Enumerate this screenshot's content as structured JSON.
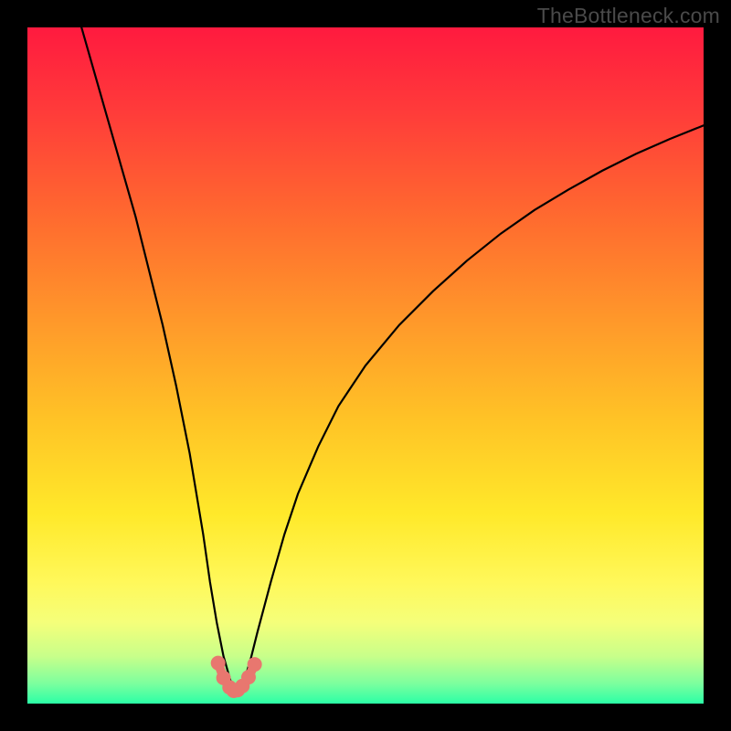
{
  "watermark": "TheBottleneck.com",
  "chart_data": {
    "type": "line",
    "title": "",
    "xlabel": "",
    "ylabel": "",
    "xlim": [
      0,
      100
    ],
    "ylim": [
      0,
      100
    ],
    "grid": false,
    "legend": false,
    "background_gradient_stops": [
      {
        "offset": 0.0,
        "color": "#ff1a3f"
      },
      {
        "offset": 0.12,
        "color": "#ff3a3a"
      },
      {
        "offset": 0.28,
        "color": "#ff6a2f"
      },
      {
        "offset": 0.44,
        "color": "#ff9a2a"
      },
      {
        "offset": 0.58,
        "color": "#ffc326"
      },
      {
        "offset": 0.72,
        "color": "#ffe92a"
      },
      {
        "offset": 0.82,
        "color": "#fff85a"
      },
      {
        "offset": 0.88,
        "color": "#f5ff7a"
      },
      {
        "offset": 0.93,
        "color": "#c8ff8a"
      },
      {
        "offset": 0.97,
        "color": "#7dff9e"
      },
      {
        "offset": 1.0,
        "color": "#2bffa6"
      }
    ],
    "series": [
      {
        "name": "bottleneck-curve",
        "color": "#000000",
        "stroke_width": 2.2,
        "x": [
          8,
          10,
          12,
          14,
          16,
          18,
          20,
          22,
          24,
          26,
          27,
          28,
          29,
          30,
          30.5,
          31,
          31.5,
          32,
          33,
          34,
          36,
          38,
          40,
          43,
          46,
          50,
          55,
          60,
          65,
          70,
          75,
          80,
          85,
          90,
          95,
          100
        ],
        "y": [
          100,
          93,
          86,
          79,
          72,
          64,
          56,
          47,
          37,
          25,
          18,
          12,
          7,
          3.5,
          2.3,
          1.8,
          2.0,
          3.2,
          6.5,
          10.5,
          18,
          25,
          31,
          38,
          44,
          50,
          56,
          61,
          65.5,
          69.5,
          73,
          76,
          78.8,
          81.3,
          83.5,
          85.5
        ]
      },
      {
        "name": "marker-arc",
        "type": "scatter",
        "color": "#e8776f",
        "marker_radius": 8,
        "connect": true,
        "connect_width": 10,
        "x": [
          28.2,
          29.0,
          29.9,
          30.5,
          31.1,
          31.8,
          32.7,
          33.6
        ],
        "y": [
          6.0,
          3.8,
          2.4,
          1.9,
          2.0,
          2.6,
          3.9,
          5.8
        ]
      }
    ]
  }
}
